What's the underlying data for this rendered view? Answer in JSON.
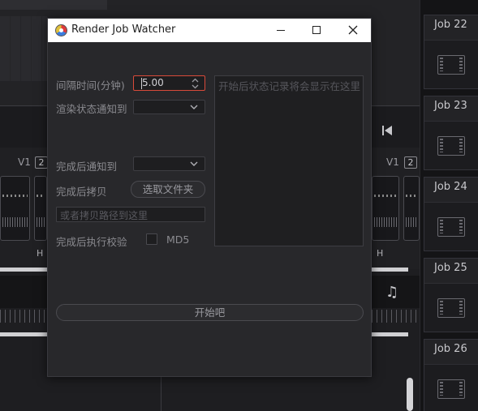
{
  "background": {
    "track_label": "V1",
    "track_number": "2",
    "clip_label": "H",
    "jobs": [
      "Job 22",
      "Job 23",
      "Job 24",
      "Job 25",
      "Job 26"
    ]
  },
  "dialog": {
    "title": "Render Job Watcher",
    "interval_label": "间隔时间(分钟)",
    "interval_value": "5.00",
    "render_status_notify_label": "渲染状态通知到",
    "complete_notify_label": "完成后通知到",
    "complete_copy_label": "完成后拷贝",
    "pick_folder_button": "选取文件夹",
    "copy_path_placeholder": "或者拷贝路径到这里",
    "complete_verify_label": "完成后执行校验",
    "md5_label": "MD5",
    "log_placeholder": "开始后状态记录将会显示在这里",
    "start_button": "开始吧"
  },
  "colors": {
    "dialog_bg": "#28282b",
    "titlebar_bg": "#ffffff",
    "focus_border": "#d94a3a"
  }
}
